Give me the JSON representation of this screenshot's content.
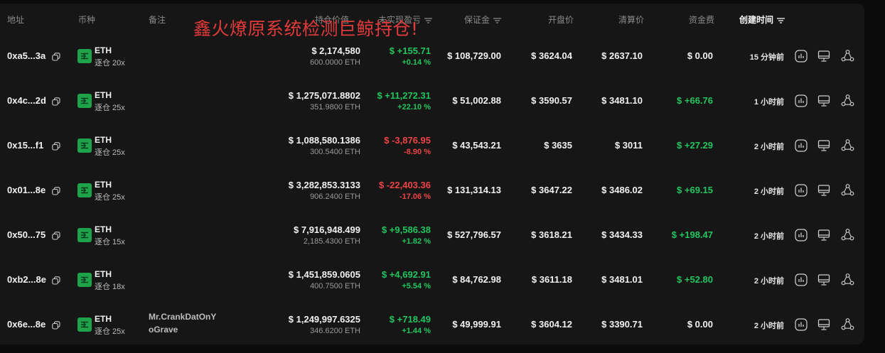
{
  "header": {
    "address": "地址",
    "coin": "币种",
    "note": "备注",
    "position_value": "持仓价值",
    "unrealized_pnl": "未实现盈亏",
    "margin": "保证金",
    "entry_price": "开盘价",
    "liq_price": "清算价",
    "funding_fee": "资金费",
    "created_time": "创建时间"
  },
  "overlay_text": "鑫火燎原系统检测巨鲸持仓!",
  "colors": {
    "positive": "#22c55e",
    "negative": "#ef4444",
    "coin_badge": "#1fa34a",
    "overlay": "#e23a3a"
  },
  "icons": {
    "copy": "copy-icon",
    "coin": "eth-coin-icon",
    "chart": "chart-icon",
    "monitor": "monitor-icon",
    "share": "share-icon",
    "filter": "filter-icon"
  },
  "rows": [
    {
      "address": "0xa5...3a",
      "coin": "ETH",
      "leverage": "逐仓 20x",
      "note": "",
      "value": "$ 2,174,580",
      "amount": "600.0000 ETH",
      "pnl": "$ +155.71",
      "pnl_pct": "+0.14 %",
      "pnl_sign": "pos",
      "margin": "$ 108,729.00",
      "entry": "$ 3624.04",
      "liq": "$ 2637.10",
      "funding": "$ 0.00",
      "funding_sign": "neutral",
      "time": "15 分钟前"
    },
    {
      "address": "0x4c...2d",
      "coin": "ETH",
      "leverage": "逐仓 25x",
      "note": "",
      "value": "$ 1,275,071.8802",
      "amount": "351.9800 ETH",
      "pnl": "$ +11,272.31",
      "pnl_pct": "+22.10 %",
      "pnl_sign": "pos",
      "margin": "$ 51,002.88",
      "entry": "$ 3590.57",
      "liq": "$ 3481.10",
      "funding": "$ +66.76",
      "funding_sign": "pos",
      "time": "1 小时前"
    },
    {
      "address": "0x15...f1",
      "coin": "ETH",
      "leverage": "逐仓 25x",
      "note": "",
      "value": "$ 1,088,580.1386",
      "amount": "300.5400 ETH",
      "pnl": "$ -3,876.95",
      "pnl_pct": "-8.90 %",
      "pnl_sign": "neg",
      "margin": "$ 43,543.21",
      "entry": "$ 3635",
      "liq": "$ 3011",
      "funding": "$ +27.29",
      "funding_sign": "pos",
      "time": "2 小时前"
    },
    {
      "address": "0x01...8e",
      "coin": "ETH",
      "leverage": "逐仓 25x",
      "note": "",
      "value": "$ 3,282,853.3133",
      "amount": "906.2400 ETH",
      "pnl": "$ -22,403.36",
      "pnl_pct": "-17.06 %",
      "pnl_sign": "neg",
      "margin": "$ 131,314.13",
      "entry": "$ 3647.22",
      "liq": "$ 3486.02",
      "funding": "$ +69.15",
      "funding_sign": "pos",
      "time": "2 小时前"
    },
    {
      "address": "0x50...75",
      "coin": "ETH",
      "leverage": "逐仓 15x",
      "note": "",
      "value": "$ 7,916,948.499",
      "amount": "2,185.4300 ETH",
      "pnl": "$ +9,586.38",
      "pnl_pct": "+1.82 %",
      "pnl_sign": "pos",
      "margin": "$ 527,796.57",
      "entry": "$ 3618.21",
      "liq": "$ 3434.33",
      "funding": "$ +198.47",
      "funding_sign": "pos",
      "time": "2 小时前"
    },
    {
      "address": "0xb2...8e",
      "coin": "ETH",
      "leverage": "逐仓 18x",
      "note": "",
      "value": "$ 1,451,859.0605",
      "amount": "400.7500 ETH",
      "pnl": "$ +4,692.91",
      "pnl_pct": "+5.54 %",
      "pnl_sign": "pos",
      "margin": "$ 84,762.98",
      "entry": "$ 3611.18",
      "liq": "$ 3481.01",
      "funding": "$ +52.80",
      "funding_sign": "pos",
      "time": "2 小时前"
    },
    {
      "address": "0x6e...8e",
      "coin": "ETH",
      "leverage": "逐仓 25x",
      "note": "Mr.CrankDatOnY oGrave",
      "note_line1": "Mr.CrankDatOnY",
      "note_line2": "oGrave",
      "value": "$ 1,249,997.6325",
      "amount": "346.6200 ETH",
      "pnl": "$ +718.49",
      "pnl_pct": "+1.44 %",
      "pnl_sign": "pos",
      "margin": "$ 49,999.91",
      "entry": "$ 3604.12",
      "liq": "$ 3390.71",
      "funding": "$ 0.00",
      "funding_sign": "neutral",
      "time": "2 小时前"
    }
  ]
}
